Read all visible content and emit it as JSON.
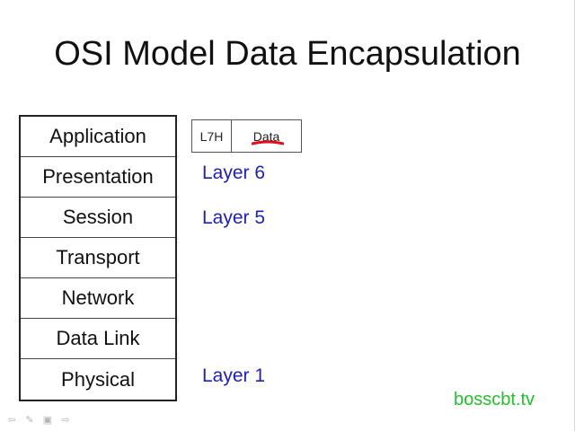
{
  "slide": {
    "title": "OSI Model Data Encapsulation"
  },
  "osi_layers": [
    "Application",
    "Presentation",
    "Session",
    "Transport",
    "Network",
    "Data Link",
    "Physical"
  ],
  "pdu": {
    "header": "L7H",
    "data": "Data"
  },
  "layer_labels": {
    "layer6": "Layer 6",
    "layer5": "Layer 5",
    "layer1": "Layer 1"
  },
  "watermark": "bosscbt.tv",
  "colors": {
    "layer_label": "#1f1fb4",
    "watermark": "#22c02a",
    "annotation": "#e0101a"
  },
  "controls": [
    "previous-icon",
    "pen-icon",
    "slide-menu-icon",
    "next-icon"
  ]
}
